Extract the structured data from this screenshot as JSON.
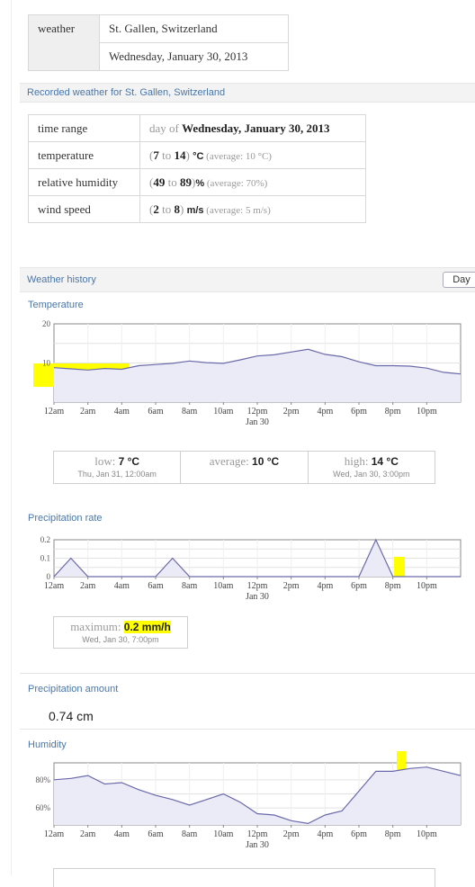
{
  "header": {
    "label": "weather",
    "location": "St. Gallen, Switzerland",
    "date": "Wednesday, January 30, 2013"
  },
  "recorded_title": "Recorded weather for St. Gallen, Switzerland",
  "recorded_rows": [
    {
      "label": "time range",
      "pre": "day of ",
      "value": "Wednesday, January 30, 2013"
    },
    {
      "label": "temperature",
      "pre": "(",
      "low": "7",
      "mid": " to ",
      "high": "14",
      "post": ") ",
      "unit": "°C",
      "avg": " (average: 10 °C)"
    },
    {
      "label": "relative humidity",
      "pre": "(",
      "low": "49",
      "mid": " to ",
      "high": "89",
      "post": ")",
      "unit": "%",
      "avg": " (average: 70%)"
    },
    {
      "label": "wind speed",
      "pre": "(",
      "low": "2",
      "mid": " to ",
      "high": "8",
      "post": ") ",
      "unit": "m/s",
      "avg": " (average: 5 m/s)"
    }
  ],
  "history": {
    "title": "Weather history",
    "button": "Day"
  },
  "x_ticks": [
    "12am",
    "2am",
    "4am",
    "6am",
    "8am",
    "10am",
    "12pm",
    "2pm",
    "4pm",
    "6pm",
    "8pm",
    "10pm"
  ],
  "x_sublabel": "Jan 30",
  "temperature": {
    "title": "Temperature",
    "stats": {
      "low_label": "low: ",
      "low_value": "7 °C",
      "low_time": "Thu, Jan 31, 12:00am",
      "avg_label": "average: ",
      "avg_value": "10 °C",
      "high_label": "high: ",
      "high_value": "14 °C",
      "high_time": "Wed, Jan 30, 3:00pm"
    }
  },
  "precipitation_rate": {
    "title": "Precipitation rate",
    "max_label": "maximum: ",
    "max_value": "0.2 mm/h",
    "max_time": "Wed, Jan 30, 7:00pm"
  },
  "precipitation_amount": {
    "title": "Precipitation amount",
    "value": "0.74 cm"
  },
  "humidity": {
    "title": "Humidity"
  },
  "colors": {
    "accent": "#4a77a8",
    "line": "#6a6aaa",
    "fill": "#ebebf7",
    "highlight": "#ffff00"
  },
  "chart_data": [
    {
      "type": "line",
      "title": "Temperature",
      "x": [
        "12am",
        "1am",
        "2am",
        "3am",
        "4am",
        "5am",
        "6am",
        "7am",
        "8am",
        "9am",
        "10am",
        "11am",
        "12pm",
        "1pm",
        "2pm",
        "3pm",
        "4pm",
        "5pm",
        "6pm",
        "7pm",
        "8pm",
        "9pm",
        "10pm",
        "11pm",
        "12am"
      ],
      "series": [
        {
          "values": [
            8.8,
            8.5,
            8.2,
            8.6,
            8.4,
            9.3,
            9.6,
            9.9,
            10.5,
            10.1,
            9.9,
            10.8,
            11.8,
            12.1,
            12.8,
            13.5,
            12.2,
            11.6,
            10.3,
            9.3,
            9.3,
            9.2,
            8.7,
            7.6,
            7.2
          ]
        }
      ],
      "ylim": [
        0,
        20
      ],
      "y_ticks": [
        "10",
        "20"
      ],
      "grid": true
    },
    {
      "type": "line",
      "title": "Precipitation rate",
      "x": [
        "12am",
        "1am",
        "2am",
        "3am",
        "4am",
        "5am",
        "6am",
        "7am",
        "8am",
        "9am",
        "10am",
        "11am",
        "12pm",
        "1pm",
        "2pm",
        "3pm",
        "4pm",
        "5pm",
        "6pm",
        "7pm",
        "8pm",
        "9pm",
        "10pm",
        "11pm",
        "12am"
      ],
      "series": [
        {
          "values": [
            0,
            0.1,
            0,
            0,
            0,
            0,
            0,
            0.1,
            0,
            0,
            0,
            0,
            0,
            0,
            0,
            0,
            0,
            0,
            0,
            0.2,
            0,
            0,
            0,
            0,
            0
          ]
        }
      ],
      "ylim": [
        0,
        0.2
      ],
      "y_ticks": [
        "0",
        "0.1",
        "0.2"
      ],
      "grid": true
    },
    {
      "type": "line",
      "title": "Humidity",
      "x": [
        "12am",
        "1am",
        "2am",
        "3am",
        "4am",
        "5am",
        "6am",
        "7am",
        "8am",
        "9am",
        "10am",
        "11am",
        "12pm",
        "1pm",
        "2pm",
        "3pm",
        "4pm",
        "5pm",
        "6pm",
        "7pm",
        "8pm",
        "9pm",
        "10pm",
        "11pm",
        "12am"
      ],
      "series": [
        {
          "values": [
            80,
            81,
            83,
            77,
            78,
            73,
            69,
            66,
            62,
            66,
            70,
            64,
            56,
            55,
            51,
            49,
            55,
            58,
            72,
            86,
            86,
            88,
            89,
            86,
            83
          ]
        }
      ],
      "ylim": [
        48,
        92
      ],
      "y_ticks": [
        "60%",
        "80%"
      ],
      "grid": true
    }
  ]
}
